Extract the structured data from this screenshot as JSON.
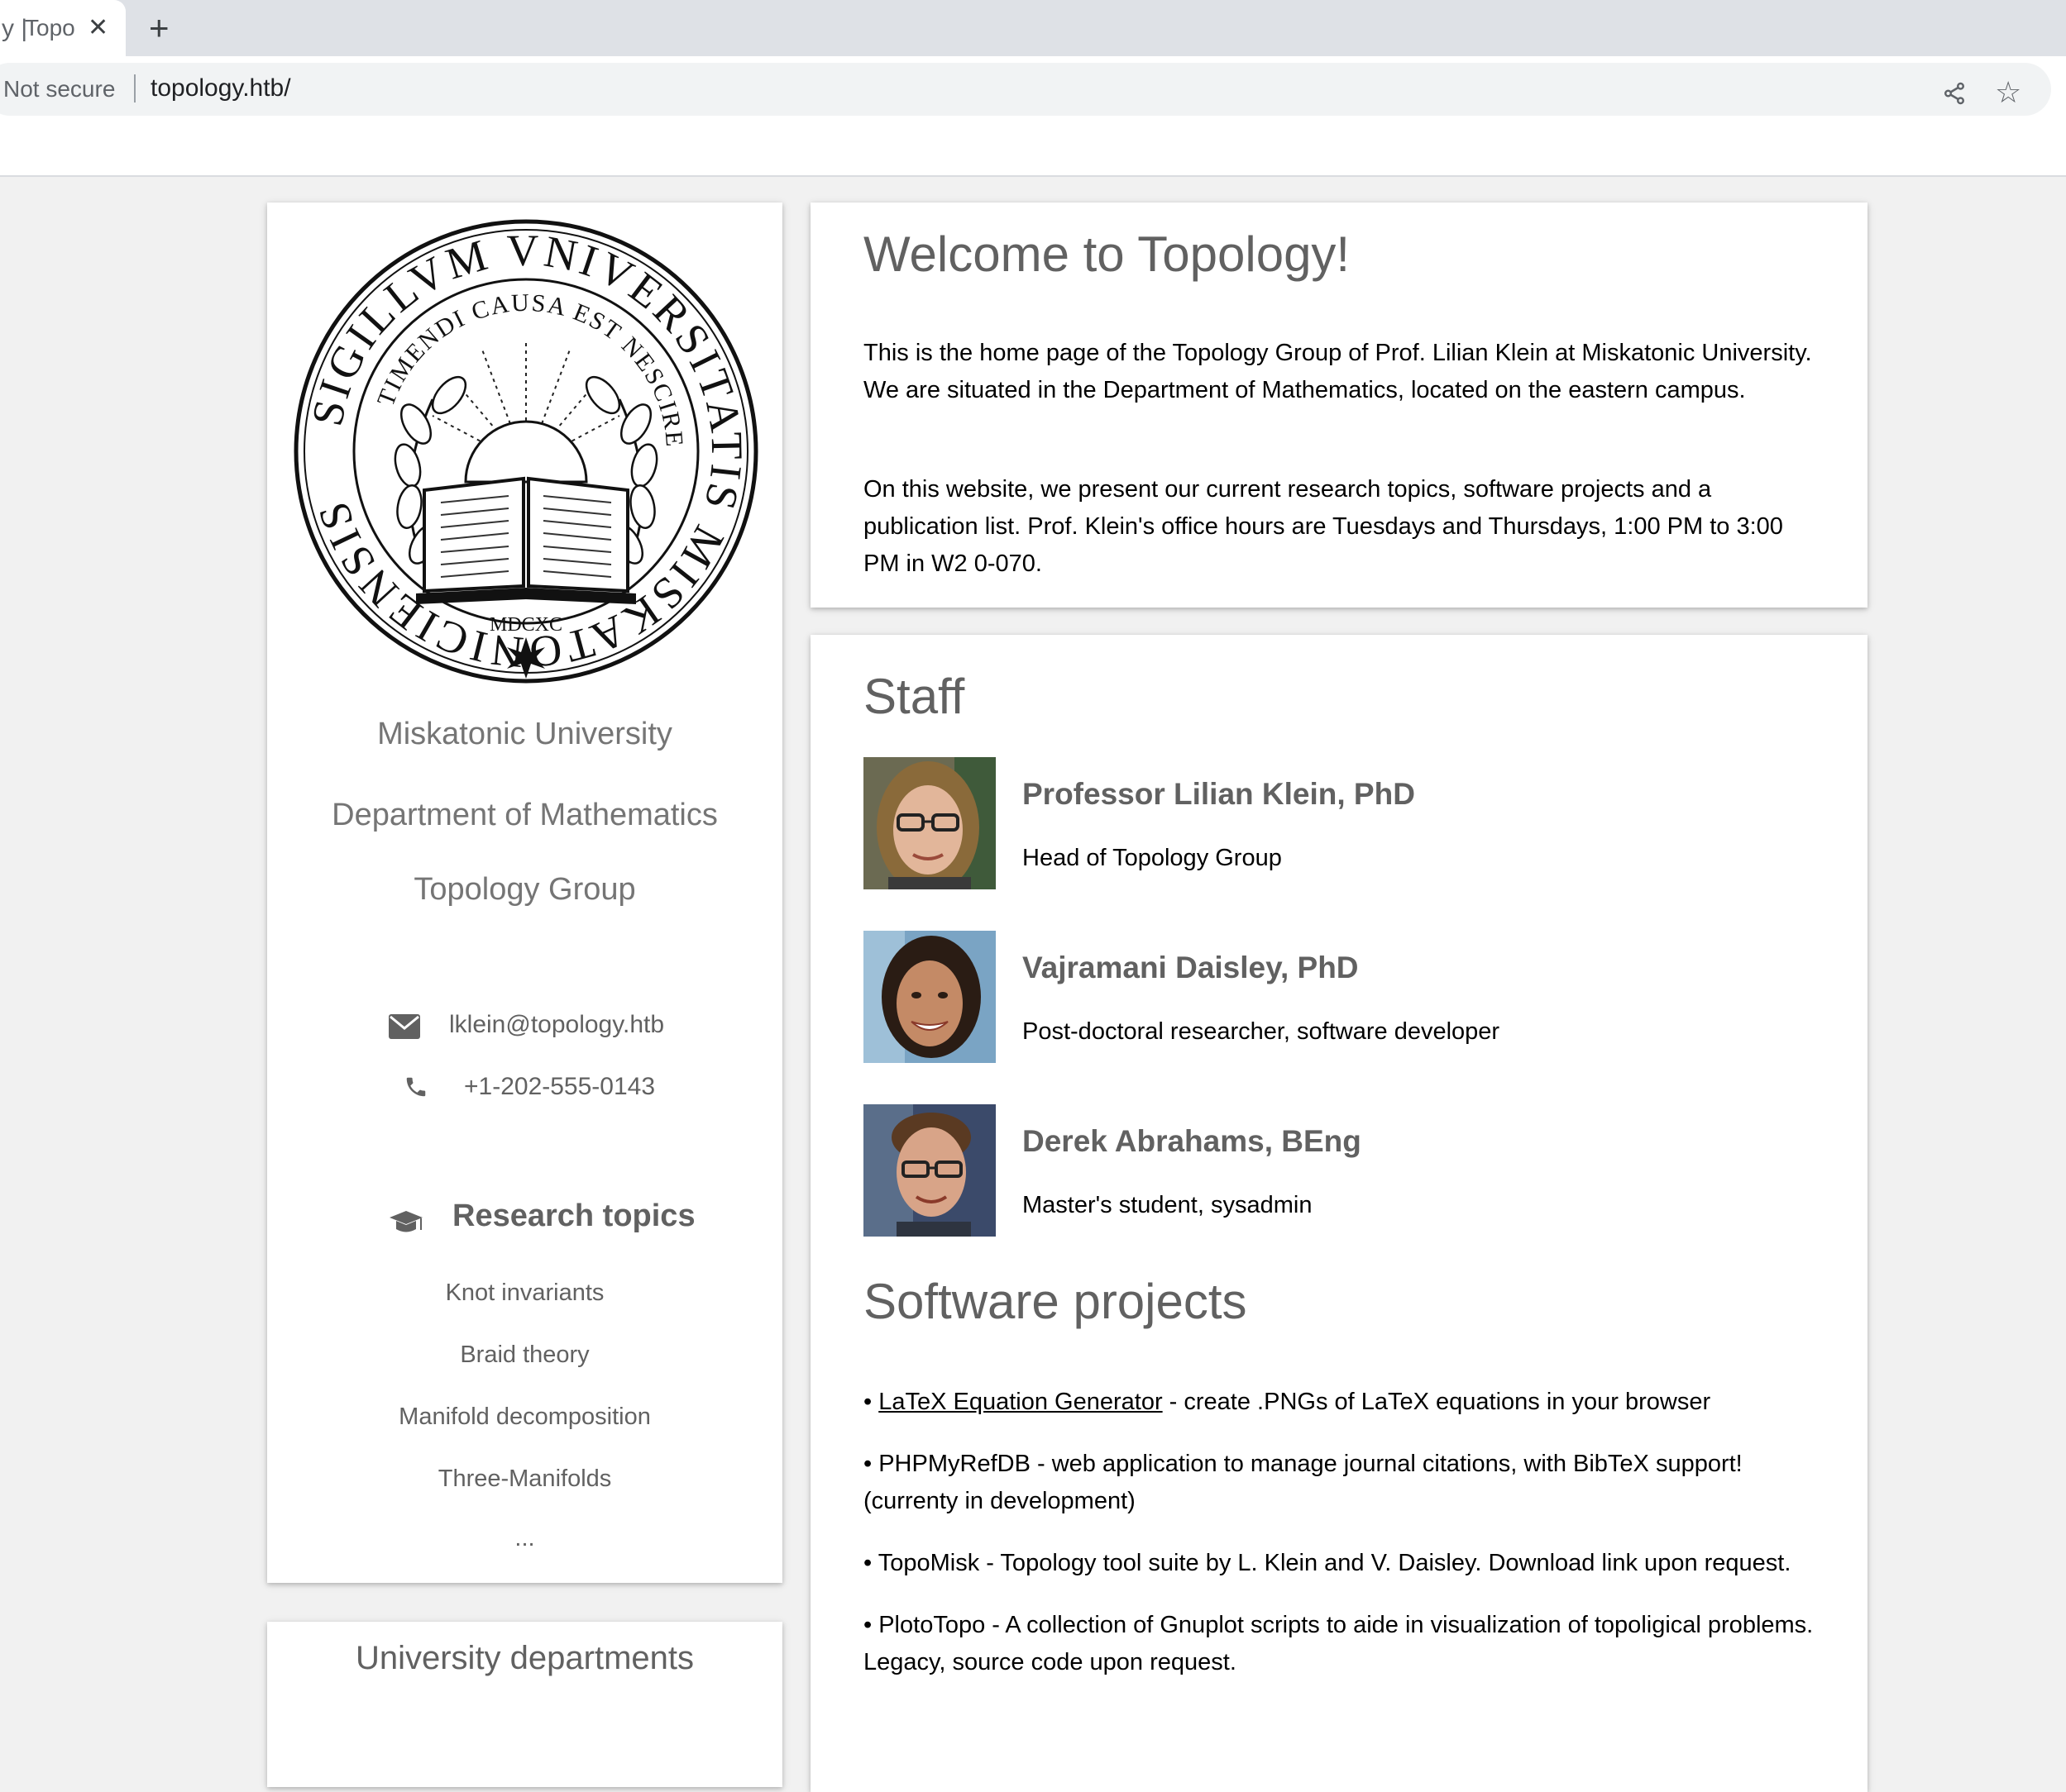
{
  "browser": {
    "tab_separator": "y |",
    "tab_title": "Topology Group",
    "tab_close": "✕",
    "new_tab": "+",
    "security_label": "Not secure",
    "url": "topology.htb/"
  },
  "sidebar": {
    "seal": {
      "outer_text": "SIGILLVM VNIVERSITATIS MISKATONICIENSIS",
      "inner_text": "TIMENDI CAUSA EST NESCIRE",
      "year": "MDCXC"
    },
    "university": "Miskatonic University",
    "department": "Department of Mathematics",
    "group": "Topology Group",
    "email": "lklein@topology.htb",
    "phone": "+1-202-555-0143",
    "research_heading": "Research topics",
    "topics": [
      "Knot invariants",
      "Braid theory",
      "Manifold decomposition",
      "Three-Manifolds",
      "..."
    ],
    "departments_heading": "University departments"
  },
  "welcome": {
    "title": "Welcome to Topology!",
    "paragraphs": [
      "This is the home page of the Topology Group of Prof. Lilian Klein at Miskatonic University. We are situated in the Department of Mathematics, located on the eastern campus.",
      "On this website, we present our current research topics, software projects and a publication list. Prof. Klein's office hours are Tuesdays and Thursdays, 1:00 PM to 3:00 PM in W2 0-070."
    ]
  },
  "staff": {
    "title": "Staff",
    "members": [
      {
        "name": "Professor Lilian Klein, PhD",
        "role": "Head of Topology Group"
      },
      {
        "name": "Vajramani Daisley, PhD",
        "role": "Post-doctoral researcher, software developer"
      },
      {
        "name": "Derek Abrahams, BEng",
        "role": "Master's student, sysadmin"
      }
    ]
  },
  "software": {
    "title": "Software projects",
    "bullet": "•",
    "items": [
      {
        "link": "LaTeX Equation Generator",
        "text": " - create .PNGs of LaTeX equations in your browser"
      },
      {
        "text": "PHPMyRefDB - web application to manage journal citations, with BibTeX support! (currenty in development)"
      },
      {
        "text": "TopoMisk - Topology tool suite by L. Klein and V. Daisley. Download link upon request."
      },
      {
        "text": "PlotoTopo - A collection of Gnuplot scripts to aide in visualization of topoligical problems. Legacy, source code upon request."
      }
    ]
  }
}
